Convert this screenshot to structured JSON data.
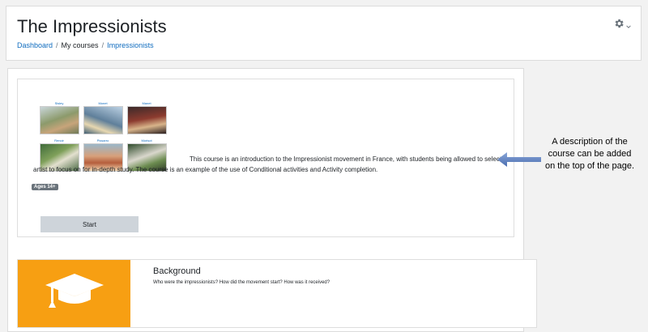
{
  "header": {
    "title": "The Impressionists",
    "breadcrumb": [
      "Dashboard",
      "My courses",
      "Impressionists"
    ],
    "breadcrumb_separator": "/",
    "settings_icon": "gear-icon"
  },
  "course": {
    "artists": [
      "Sisley",
      "Monet",
      "Manet",
      "Renoir",
      "Pissarro",
      "Morisot"
    ],
    "description": "This course is an introduction to the Impressionist movement in France, with students being allowed to select an artist to focus on for in-depth study. The course is an example of the use of Conditional activities and Activity completion.",
    "badge": "Ages 14+",
    "start_button": "Start"
  },
  "section": {
    "icon": "graduation-cap-icon",
    "title": "Background",
    "text": "Who were the impressionists?  How did the movement start? How was it received?"
  },
  "annotation": {
    "text": "A description of the course can be added on the top of the page.",
    "arrow_color": "#5b7dbf"
  },
  "colors": {
    "link": "#0f6cbf",
    "section_thumb": "#f79f12",
    "badge": "#6a737b",
    "button": "#ced4da"
  }
}
